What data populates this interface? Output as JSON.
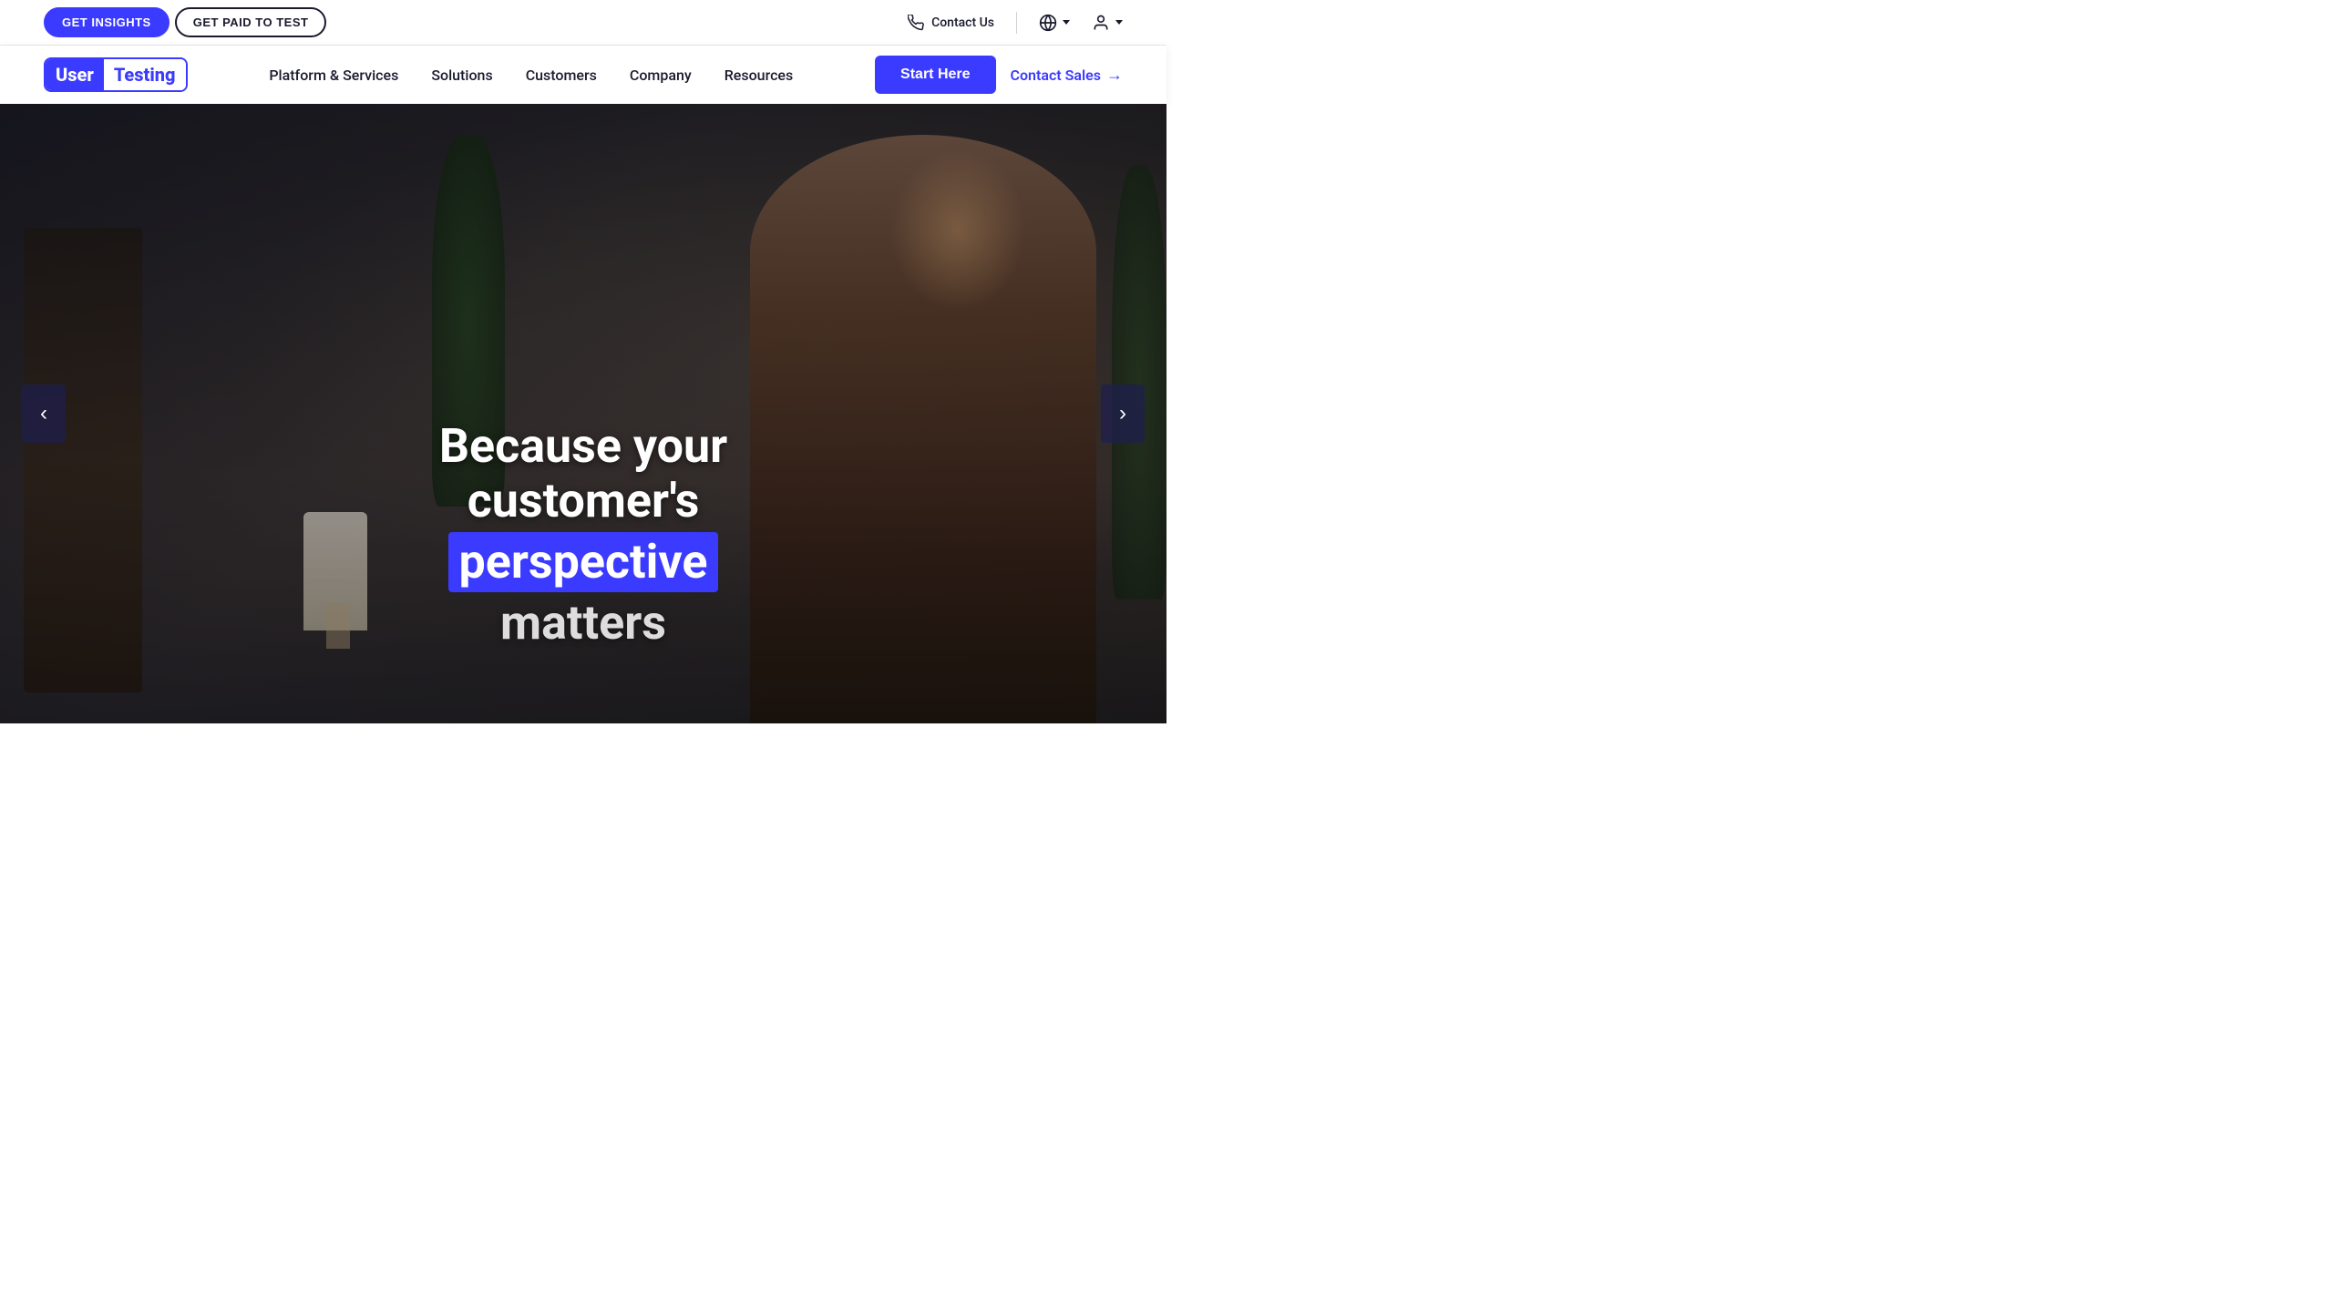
{
  "topbar": {
    "btn_get_insights": "GET INSIGHTS",
    "btn_get_paid": "GET PAID TO TEST",
    "contact_us": "Contact Us",
    "contact_phone_icon": "phone-icon",
    "globe_icon": "globe-icon",
    "user_icon": "user-icon"
  },
  "nav": {
    "logo_user": "User",
    "logo_testing": "Testing",
    "links": [
      {
        "label": "Platform & Services",
        "id": "platform-services"
      },
      {
        "label": "Solutions",
        "id": "solutions"
      },
      {
        "label": "Customers",
        "id": "customers"
      },
      {
        "label": "Company",
        "id": "company"
      },
      {
        "label": "Resources",
        "id": "resources"
      }
    ],
    "btn_start_here": "Start Here",
    "btn_contact_sales": "Contact Sales"
  },
  "hero": {
    "line1": "Because your",
    "line2": "customer's",
    "highlight": "perspective",
    "line4": "matters",
    "carousel_prev": "‹",
    "carousel_next": "›"
  },
  "colors": {
    "brand_blue": "#3b3bff",
    "text_dark": "#1a1a2e",
    "white": "#ffffff"
  }
}
